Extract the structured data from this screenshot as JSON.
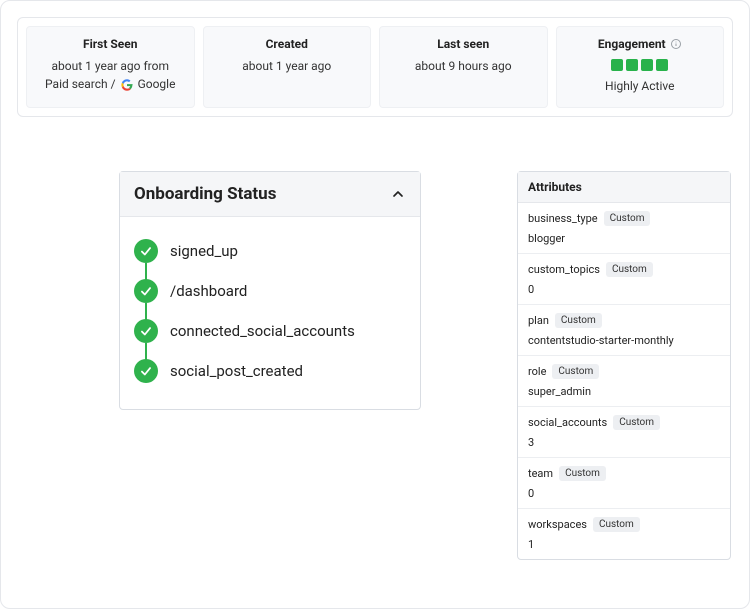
{
  "stats": {
    "first_seen": {
      "title": "First Seen",
      "line1": "about 1 year ago from",
      "source_prefix": "Paid search /",
      "source_name": "Google"
    },
    "created": {
      "title": "Created",
      "value": "about 1 year ago"
    },
    "last_seen": {
      "title": "Last seen",
      "value": "about 9 hours ago"
    },
    "engagement": {
      "title": "Engagement",
      "level": "Highly Active"
    }
  },
  "onboarding": {
    "title": "Onboarding Status",
    "steps": [
      {
        "label": "signed_up"
      },
      {
        "label": "/dashboard"
      },
      {
        "label": "connected_social_accounts"
      },
      {
        "label": "social_post_created"
      }
    ]
  },
  "attributes": {
    "title": "Attributes",
    "badge": "Custom",
    "items": [
      {
        "key": "business_type",
        "value": "blogger"
      },
      {
        "key": "custom_topics",
        "value": "0"
      },
      {
        "key": "plan",
        "value": "contentstudio-starter-monthly"
      },
      {
        "key": "role",
        "value": "super_admin"
      },
      {
        "key": "social_accounts",
        "value": "3"
      },
      {
        "key": "team",
        "value": "0"
      },
      {
        "key": "workspaces",
        "value": "1"
      }
    ]
  }
}
